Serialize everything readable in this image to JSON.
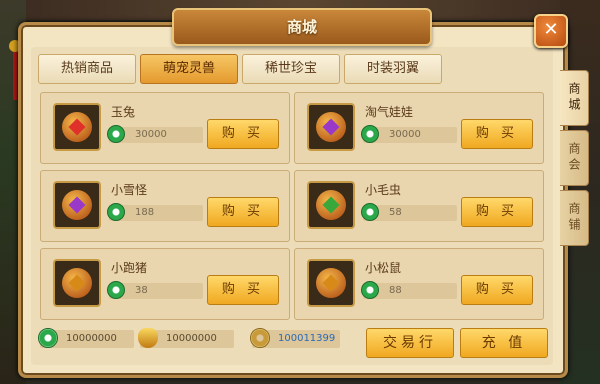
{
  "window": {
    "title": "商城",
    "close_label": "✕"
  },
  "tabs": [
    {
      "label": "热销商品",
      "active": false
    },
    {
      "label": "萌宠灵兽",
      "active": true
    },
    {
      "label": "稀世珍宝",
      "active": false
    },
    {
      "label": "时装羽翼",
      "active": false
    }
  ],
  "items": [
    {
      "name": "玉兔",
      "price": "30000",
      "buy_label": "购 买",
      "icon": "pet-egg-red"
    },
    {
      "name": "淘气娃娃",
      "price": "30000",
      "buy_label": "购 买",
      "icon": "pet-egg-purple"
    },
    {
      "name": "小雪怪",
      "price": "188",
      "buy_label": "购 买",
      "icon": "pet-egg-purple"
    },
    {
      "name": "小毛虫",
      "price": "58",
      "buy_label": "购 买",
      "icon": "pet-egg-green"
    },
    {
      "name": "小跑猪",
      "price": "38",
      "buy_label": "购 买",
      "icon": "pet-egg-gold"
    },
    {
      "name": "小松鼠",
      "price": "88",
      "buy_label": "购 买",
      "icon": "pet-egg-gold"
    }
  ],
  "currency": {
    "jade": "10000000",
    "gold_ingot": "10000000",
    "bound_coin": "100011399"
  },
  "actions": {
    "trade_label": "交易行",
    "recharge_label": "充 值"
  },
  "side_tabs": [
    {
      "label": "商城",
      "active": true
    },
    {
      "label": "商会",
      "active": false
    },
    {
      "label": "商铺",
      "active": false
    }
  ],
  "colors": {
    "accent": "#f0a820",
    "panel": "#f3e4c2",
    "frame": "#b88a47"
  }
}
